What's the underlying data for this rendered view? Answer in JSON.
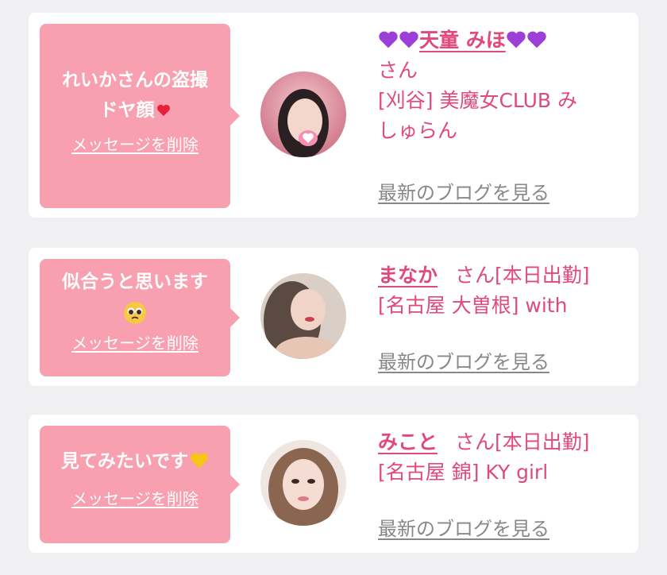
{
  "items": [
    {
      "message": "れいかさんの盗撮ドヤ顔",
      "message_line1": "れいかさんの盗撮",
      "message_line2": "ドヤ顔",
      "delete_label": "メッセージを削除",
      "name": "天童 みほ",
      "name_suffix": "さん",
      "shop": "[刈谷] 美魔女CLUB みしゅらん",
      "shop_line1": "[刈谷] 美魔女CLUB み",
      "shop_line2": "しゅらん",
      "blog_link": "最新のブログを見る",
      "avatar_icon": "profile-photo"
    },
    {
      "message": "似合うと思います",
      "delete_label": "メッセージを削除",
      "name": "まなか",
      "name_suffix": "さん[本日出勤]",
      "shop": "[名古屋 大曽根] with",
      "blog_link": "最新のブログを見る",
      "avatar_icon": "profile-photo"
    },
    {
      "message": "見てみたいです",
      "delete_label": "メッセージを削除",
      "name": "みこと",
      "name_suffix": "さん[本日出勤]",
      "shop": "[名古屋 錦] KY girl",
      "blog_link": "最新のブログを見る",
      "avatar_icon": "profile-photo"
    }
  ],
  "colors": {
    "background": "#f0eff2",
    "card": "#ffffff",
    "bubble": "#f89fb0",
    "accent": "#e04a7a",
    "muted": "#888888"
  }
}
